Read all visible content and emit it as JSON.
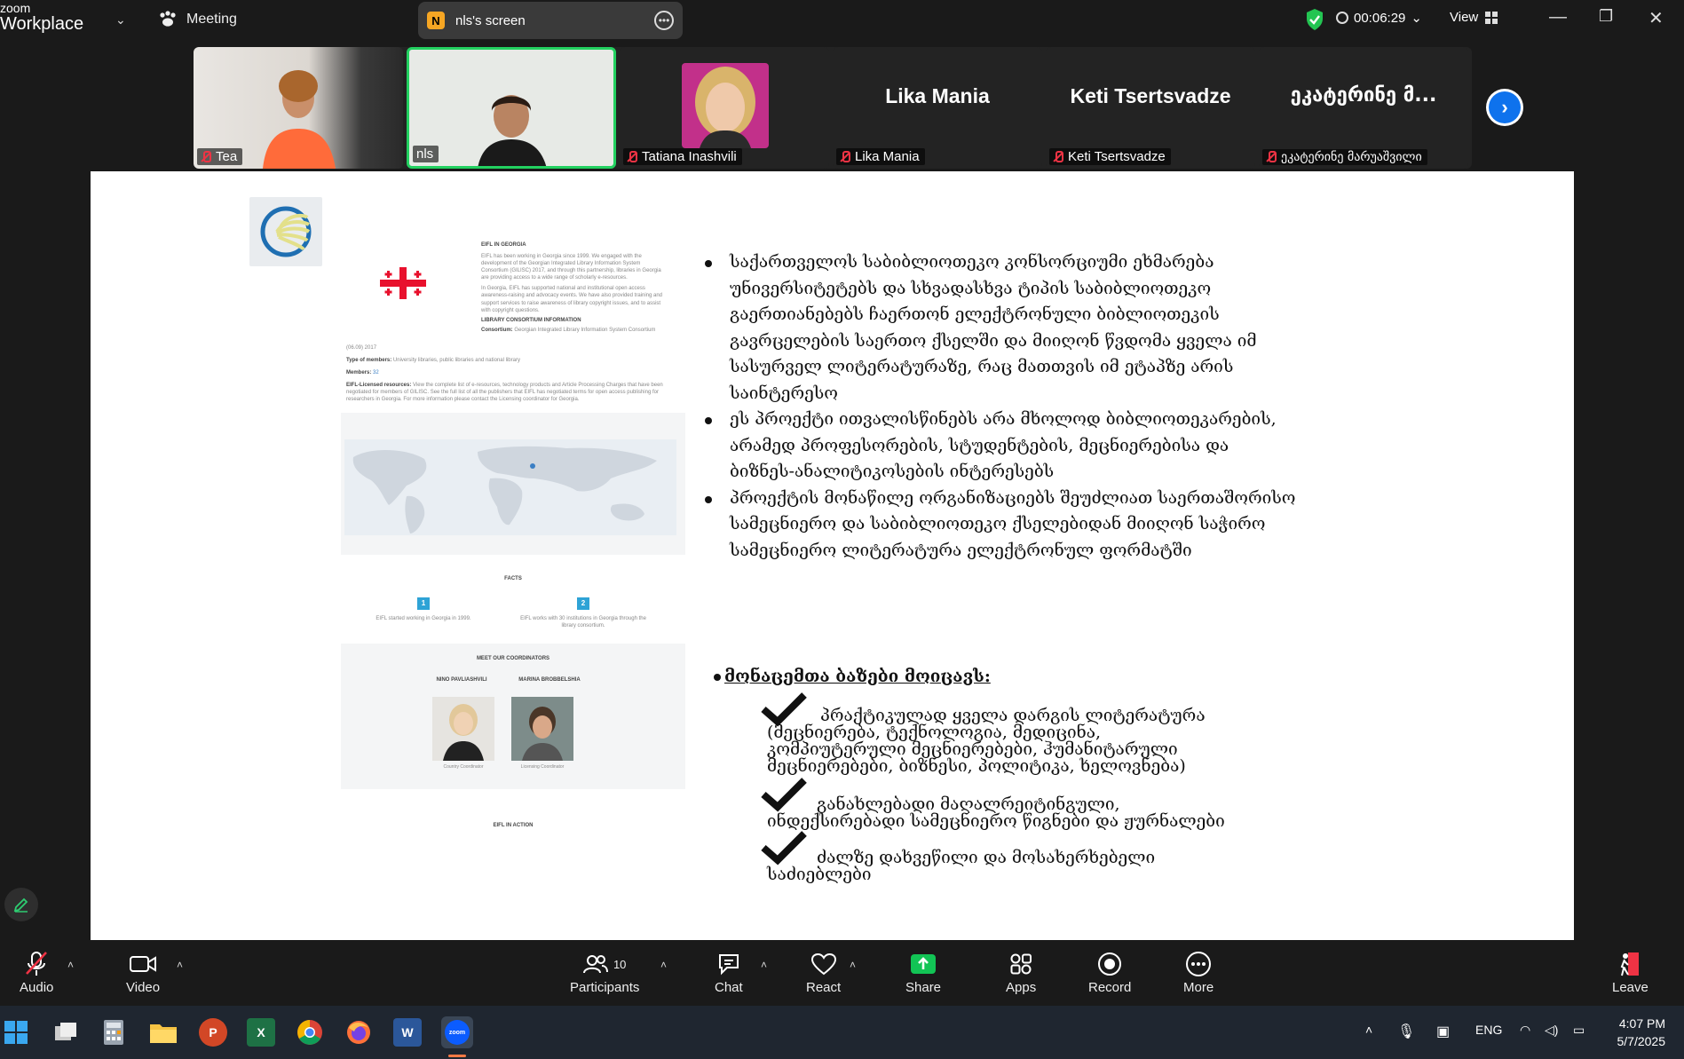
{
  "app": {
    "brand_line1": "zoom",
    "brand_line2": "Workplace"
  },
  "topbar": {
    "meeting_label": "Meeting",
    "screen_badge": "N",
    "screen_title": "nls's screen",
    "timer": "00:06:29",
    "view_label": "View"
  },
  "gallery": {
    "tiles": [
      {
        "name": "Tea",
        "kind": "video"
      },
      {
        "name": "nls",
        "kind": "video",
        "active": true
      },
      {
        "name": "Tatiana Inashvili",
        "kind": "photo"
      },
      {
        "name": "Lika Mania",
        "display": "Lika Mania"
      },
      {
        "name": "Keti Tsertsvadze",
        "display": "Keti Tsertsvadze"
      },
      {
        "name": "ეკატერინე მარუაშვილი",
        "display": "ეკატერინე მ..."
      }
    ]
  },
  "slide": {
    "bullets": [
      "საქართველოს საბიბლიოთეკო კონსორციუმი ეხმარება უნივერსიტეტებს და სხვადასხვა ტიპის საბიბლიოთეკო გაერთიანებებს ჩაერთონ ელექტრონული ბიბლიოთეკის გავრცელების საერთო ქსელში და მიიღონ წვდომა ყველა იმ სასურველ ლიტერატურაზე, რაც მათთვის იმ ეტაპზე არის საინტერესო",
      "ეს პროექტი ითვალისწინებს არა მხოლოდ ბიბლიოთეკარების, არამედ პროფესორების, სტუდენტების, მეცნიერებისა და ბიზნეს-ანალიტიკოსების ინტერესებს",
      "პროექტის მონაწილე ორგანიზაციებს შეუძლიათ საერთაშორისო სამეცნიერო და საბიბლიოთეკო ქსელებიდან მიიღონ საჭირო სამეცნიერო ლიტერატურა ელექტრონულ ფორმატში"
    ],
    "db_heading": "მონაცემთა ბაზები მოიცავს:",
    "db_items": [
      {
        "line1": "პრაქტიკულად ყველა დარგის ლიტერატურა",
        "rest": [
          "(მეცნიერება, ტექნოლოგია, მედიცინა,",
          "კომპიუტერული მეცნიერებები, ჰუმანიტარული",
          "მეცნიერებები, ბიზნესი, პოლიტიკა, ხელოვნება)"
        ]
      },
      {
        "line1": "განახლებადი მაღალრეიტინგული,",
        "rest": [
          "ინდექსირებადი სამეცნიერო წიგნები და ჟურნალები"
        ]
      },
      {
        "line1": "ძალზე დახვეწილი და მოსახერხებელი",
        "rest": [
          "საძიებლები"
        ]
      }
    ],
    "website": {
      "section_title": "EIFL IN GEORGIA",
      "intro": "EIFL has been working in Georgia since 1999. We engaged with the development of the Georgian Integrated Library Information System Consortium (GILISC) 2017, and through this partnership, libraries in Georgia are providing access to a wide range of scholarly e-resources.",
      "intro2": "In Georgia, EIFL has supported national and institutional open access awareness-raising and advocacy events. We have also provided training and support services to raise awareness of library copyright issues, and to assist with copyright questions.",
      "consortium_title": "LIBRARY CONSORTIUM INFORMATION",
      "consortium_label": "Consortium:",
      "consortium_value": "Georgian Integrated Library Information System Consortium",
      "date": "(06.09) 2017",
      "members_type_label": "Type of members:",
      "members_type_value": "University libraries, public libraries and national library",
      "members_label": "Members:",
      "members_value": "32",
      "licensed_label": "EIFL-Licensed resources:",
      "licensed_value": "View the complete list of e-resources, technology products and Article Processing Charges that have been negotiated for members of GILISC. See the full list of all the publishers that EIFL has negotiated terms for open access publishing for researchers in Georgia. For more information please contact the Licensing coordinator for Georgia.",
      "facts_title": "FACTS",
      "fact1_num": "1",
      "fact1_text": "EIFL started working in Georgia in 1999.",
      "fact2_num": "2",
      "fact2_text": "EIFL works with 30 institutions in Georgia through the library consortium.",
      "coordinators_title": "MEET OUR COORDINATORS",
      "coord1_name": "NINO PAVLIASHVILI",
      "coord1_role": "Country Coordinator",
      "coord2_name": "MARINA BROBBELSHIA",
      "coord2_role": "Licensing Coordinator",
      "action_title": "EIFL IN ACTION"
    }
  },
  "toolbar": {
    "audio": "Audio",
    "video": "Video",
    "participants": "Participants",
    "participants_count": "10",
    "chat": "Chat",
    "react": "React",
    "share": "Share",
    "apps": "Apps",
    "record": "Record",
    "more": "More",
    "leave": "Leave"
  },
  "taskbar": {
    "lang": "ENG",
    "time": "4:07 PM",
    "date": "5/7/2025"
  },
  "colors": {
    "accent": "#0e72ed",
    "share_green": "#12c455",
    "active_border": "#23d160",
    "muted_red": "#e34"
  }
}
